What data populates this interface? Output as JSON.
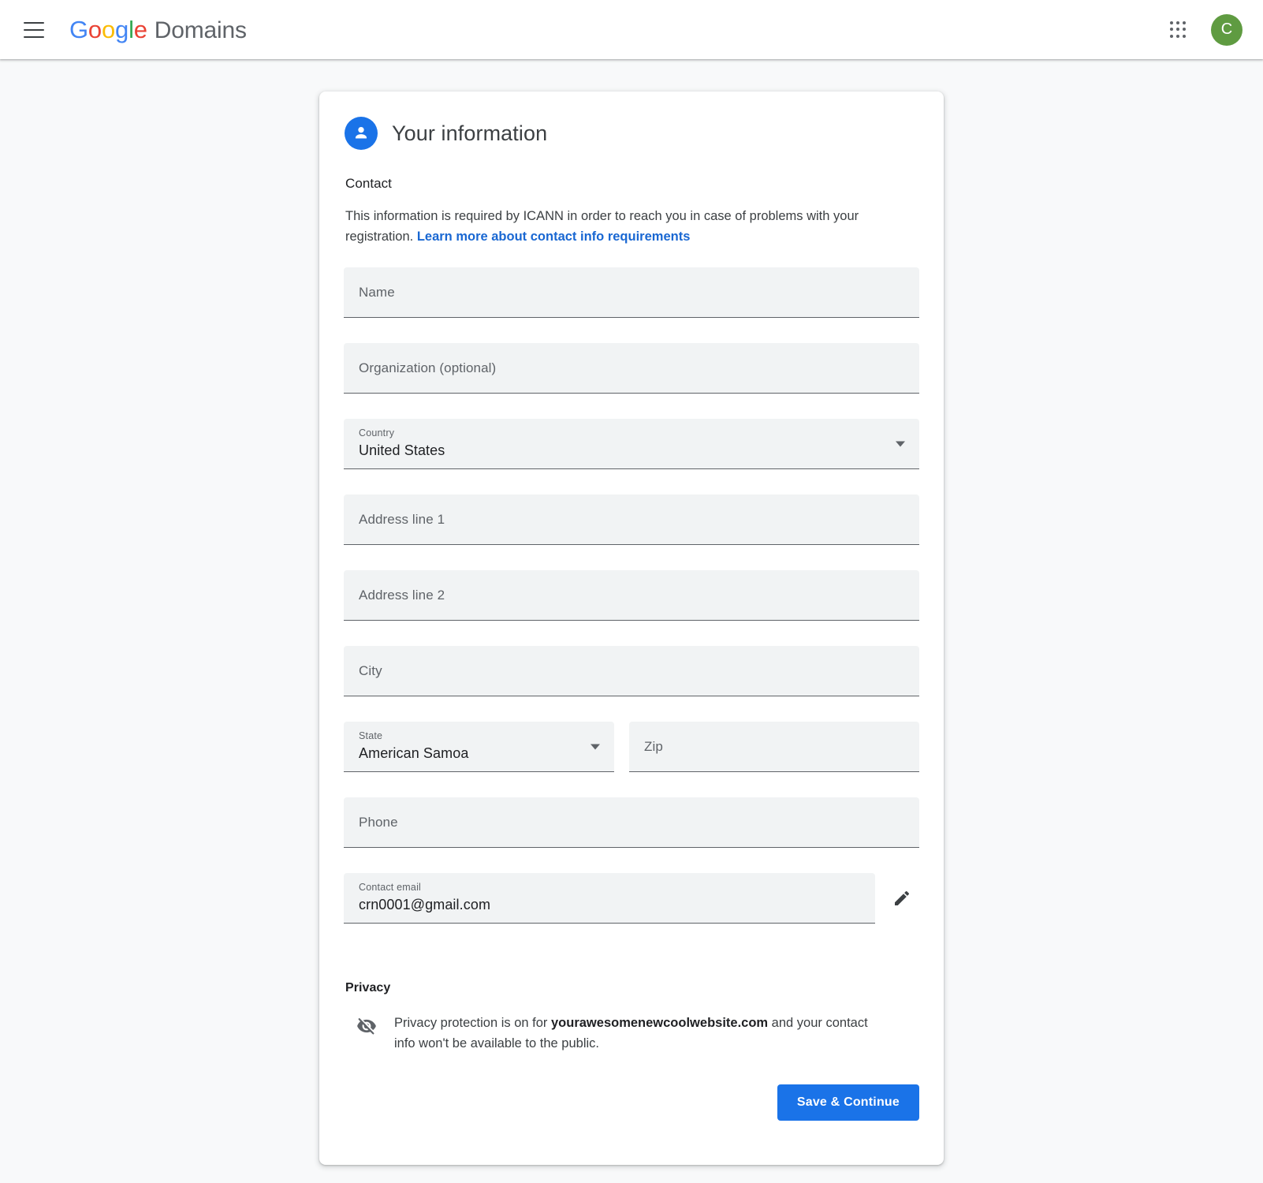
{
  "appbar": {
    "menu_label": "Main menu",
    "brand_letters": [
      "G",
      "o",
      "o",
      "g",
      "l",
      "e"
    ],
    "product": "Domains",
    "apps_label": "Google apps",
    "avatar_initial": "C"
  },
  "card": {
    "title": "Your information",
    "header_icon": "person-icon",
    "contact": {
      "section_title": "Contact",
      "description_before": "This information is required by ICANN in order to reach you in case of problems with your registration.",
      "link_text": "Learn more about contact info requirements",
      "fields": [
        {
          "name": "name",
          "placeholder": "Name",
          "label": "",
          "value": "",
          "type": "text"
        },
        {
          "name": "organization",
          "placeholder": "Organization (optional)",
          "label": "",
          "value": "",
          "type": "text"
        },
        {
          "name": "country",
          "placeholder": "",
          "label": "Country",
          "value": "United States",
          "type": "select"
        },
        {
          "name": "address-line-1",
          "placeholder": "Address line 1",
          "label": "",
          "value": "",
          "type": "text"
        },
        {
          "name": "address-line-2",
          "placeholder": "Address line 2",
          "label": "",
          "value": "",
          "type": "text"
        },
        {
          "name": "city",
          "placeholder": "City",
          "label": "",
          "value": "",
          "type": "text"
        },
        {
          "name": "state",
          "placeholder": "",
          "label": "State",
          "value": "American Samoa",
          "type": "select"
        },
        {
          "name": "zip",
          "placeholder": "Zip",
          "label": "",
          "value": "",
          "type": "text"
        },
        {
          "name": "phone",
          "placeholder": "Phone",
          "label": "",
          "value": "",
          "type": "text"
        },
        {
          "name": "contact-email",
          "placeholder": "",
          "label": "Contact email",
          "value": "crn0001@gmail.com",
          "type": "text"
        }
      ],
      "edit_email_icon": "pencil-icon"
    },
    "privacy": {
      "section_title": "Privacy",
      "icon": "eye-off-icon",
      "text_before": "Privacy protection is on for ",
      "domain": "yourawesomenewcoolwebsite.com",
      "text_after": " and your contact info won't be available to the public."
    },
    "footer": {
      "primary_button": "Save & Continue"
    }
  },
  "colors": {
    "accent": "#1a73e8",
    "link": "#1967d2",
    "page_bg": "#f8f9fa",
    "field_bg": "#f1f3f4",
    "avatar_bg": "#5f9b41",
    "google_blue": "#4285F4",
    "google_red": "#EA4335",
    "google_yellow": "#FBBC05",
    "google_green": "#34A853"
  }
}
